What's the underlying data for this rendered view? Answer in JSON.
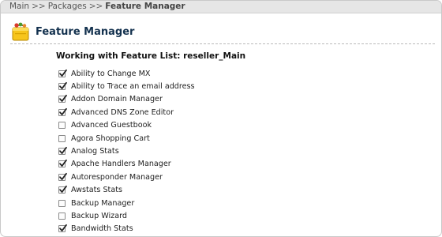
{
  "breadcrumb": {
    "items": [
      "Main",
      "Packages"
    ],
    "separator": ">>",
    "current": "Feature Manager"
  },
  "header": {
    "title": "Feature Manager",
    "icon": "shopping-bag-icon"
  },
  "list": {
    "title": "Working with Feature List: reseller_Main"
  },
  "features": [
    {
      "label": "Ability to Change MX",
      "checked": true
    },
    {
      "label": "Ability to Trace an email address",
      "checked": true
    },
    {
      "label": "Addon Domain Manager",
      "checked": true
    },
    {
      "label": "Advanced DNS Zone Editor",
      "checked": true
    },
    {
      "label": "Advanced Guestbook",
      "checked": false
    },
    {
      "label": "Agora Shopping Cart",
      "checked": false
    },
    {
      "label": "Analog Stats",
      "checked": true
    },
    {
      "label": "Apache Handlers Manager",
      "checked": true
    },
    {
      "label": "Autoresponder Manager",
      "checked": true
    },
    {
      "label": "Awstats Stats",
      "checked": true
    },
    {
      "label": "Backup Manager",
      "checked": false
    },
    {
      "label": "Backup Wizard",
      "checked": false
    },
    {
      "label": "Bandwidth Stats",
      "checked": true
    }
  ],
  "colors": {
    "title": "#13314e",
    "breadcrumb_bg": "#e6e6e6"
  }
}
